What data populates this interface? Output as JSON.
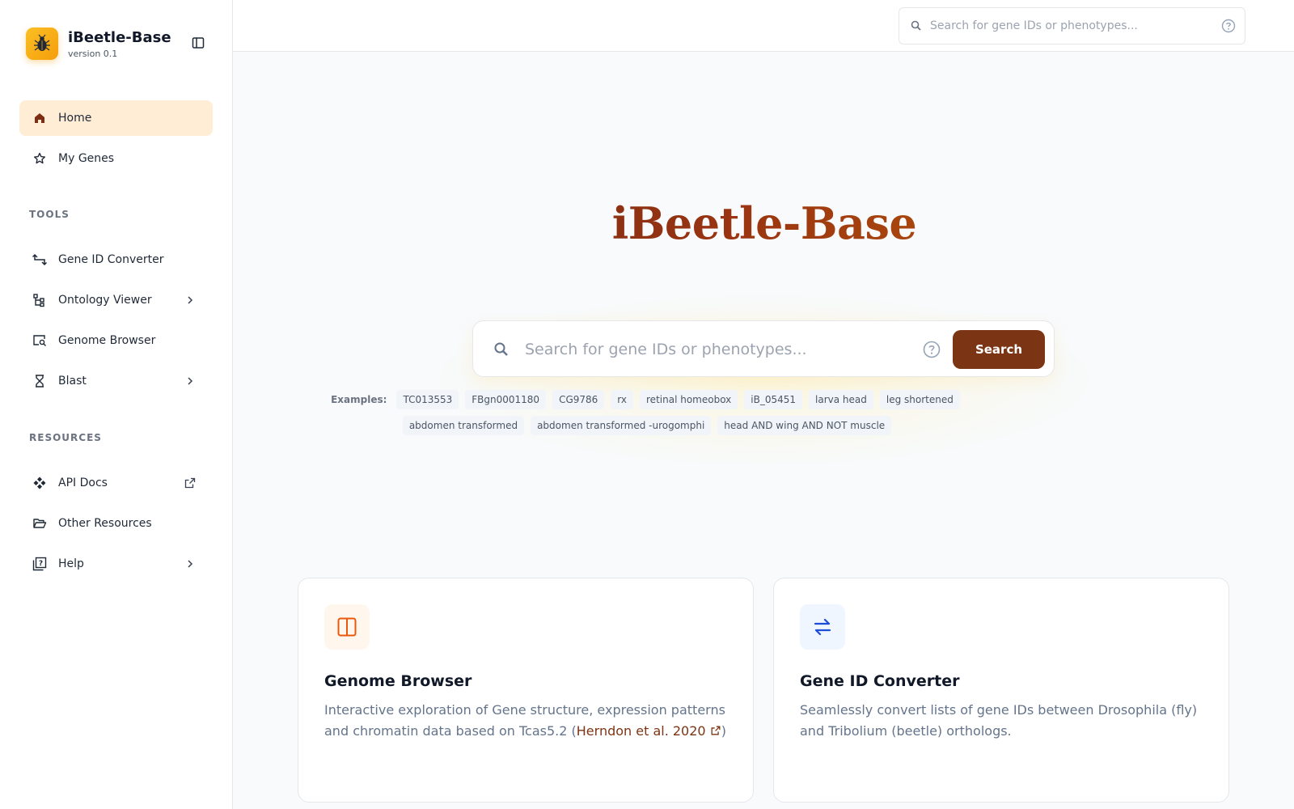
{
  "brand": {
    "title": "iBeetle-Base",
    "version": "version 0.1"
  },
  "nav": {
    "home": "Home",
    "my_genes": "My Genes",
    "tools_label": "TOOLS",
    "gene_id_converter": "Gene ID Converter",
    "ontology_viewer": "Ontology Viewer",
    "genome_browser": "Genome Browser",
    "blast": "Blast",
    "resources_label": "RESOURCES",
    "api_docs": "API Docs",
    "other_resources": "Other Resources",
    "help": "Help"
  },
  "topbar": {
    "search_placeholder": "Search for gene IDs or phenotypes..."
  },
  "hero": {
    "title": "iBeetle-Base",
    "search_placeholder": "Search for gene IDs or phenotypes...",
    "search_button": "Search",
    "examples_label": "Examples:",
    "examples_row1": [
      "TC013553",
      "FBgn0001180",
      "CG9786",
      "rx",
      "retinal homeobox",
      "iB_05451",
      "larva head",
      "leg shortened"
    ],
    "examples_row2": [
      "abdomen transformed",
      "abdomen transformed -urogomphi",
      "head AND wing AND NOT muscle"
    ]
  },
  "cards": {
    "genome_browser": {
      "title": "Genome Browser",
      "desc_prefix": "Interactive exploration of Gene structure, expression patterns and chromatin data based on Tcas5.2 (",
      "link": "Herndon et al. 2020",
      "desc_suffix": ")"
    },
    "gene_id_converter": {
      "title": "Gene ID Converter",
      "desc": "Seamlessly convert lists of gene IDs between Drosophila (fly) and Tribolium (beetle) orthologs."
    }
  },
  "colors": {
    "accent": "#7c3514",
    "active_nav_bg": "#ffedd5",
    "logo": "#f59e0b"
  }
}
